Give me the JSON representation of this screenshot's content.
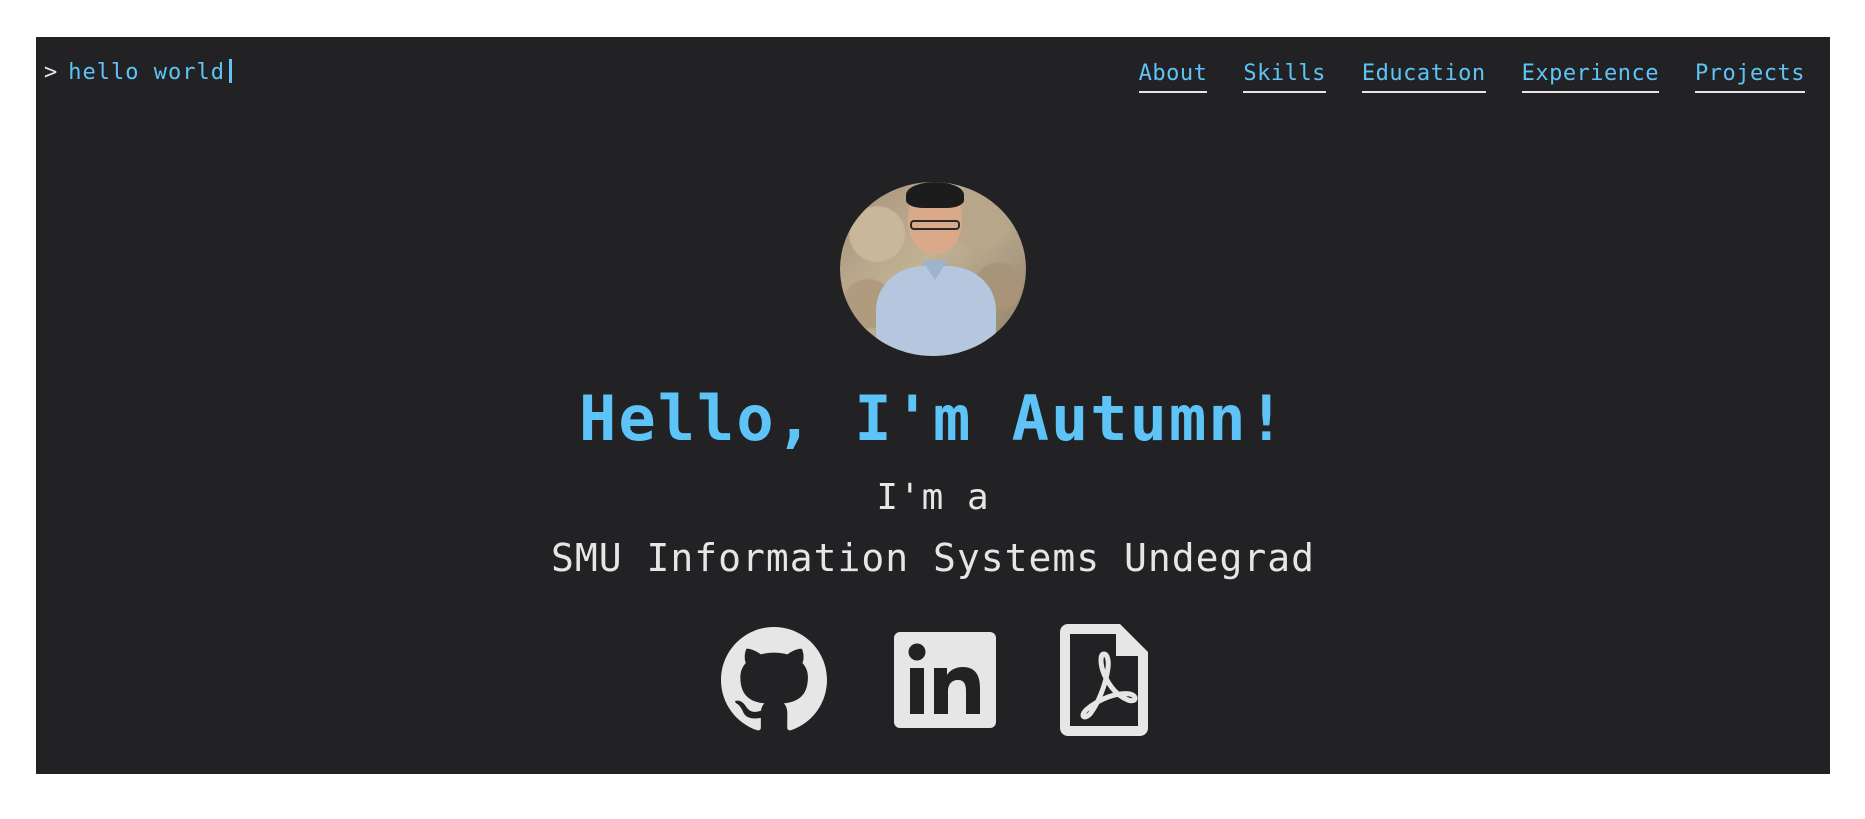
{
  "terminal": {
    "prompt_symbol": ">",
    "text": "hello world"
  },
  "nav": {
    "items": [
      {
        "label": "About"
      },
      {
        "label": "Skills"
      },
      {
        "label": "Education"
      },
      {
        "label": "Experience"
      },
      {
        "label": "Projects"
      }
    ]
  },
  "hero": {
    "greeting": "Hello, I'm Autumn!",
    "subline": "I'm a",
    "role": "SMU Information Systems Undegrad"
  },
  "social": {
    "icons": [
      "github-icon",
      "linkedin-icon",
      "pdf-resume-icon"
    ]
  },
  "colors": {
    "background": "#222224",
    "accent": "#5ec4f7",
    "text": "#e6e6e6"
  }
}
